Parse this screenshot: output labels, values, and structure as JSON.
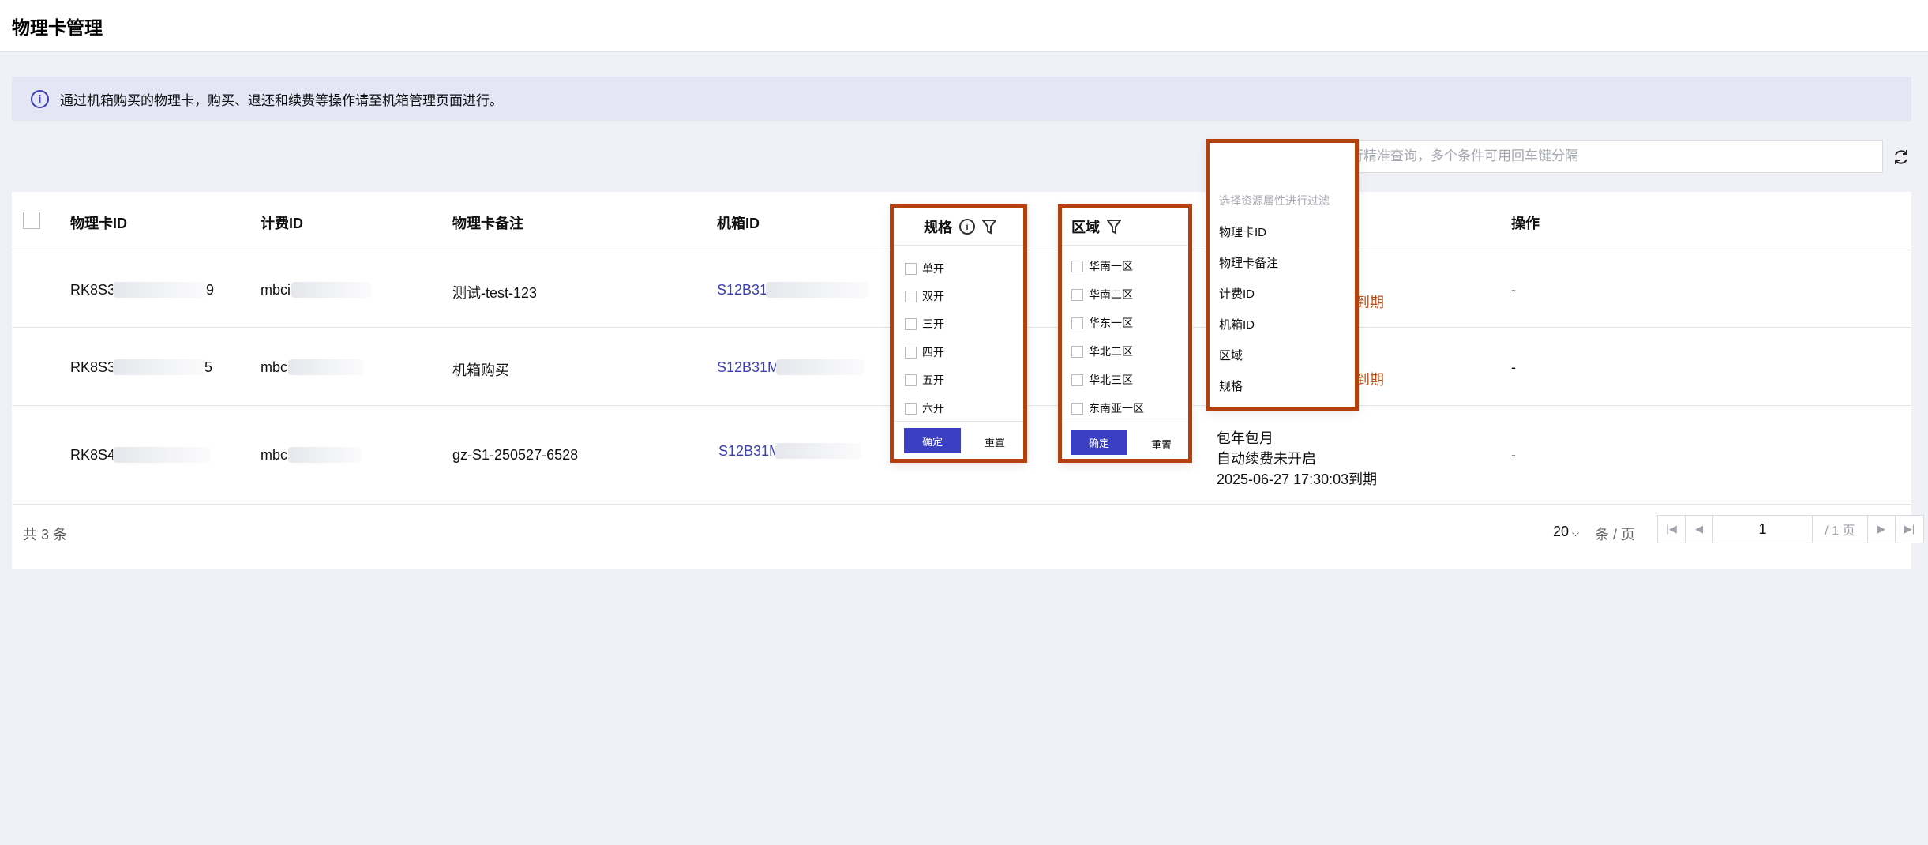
{
  "page": {
    "title": "物理卡管理"
  },
  "notice": {
    "icon": "info-icon",
    "text": "通过机箱购买的物理卡，购买、退还和续费等操作请至机箱管理页面进行。"
  },
  "search": {
    "placeholder": "请输入关键字进行精准查询，多个条件可用回车键分隔"
  },
  "table": {
    "headers": {
      "card_id": "物理卡ID",
      "billing_id": "计费ID",
      "remark": "物理卡备注",
      "chassis_id": "机箱ID",
      "spec": "规格",
      "region": "区域",
      "actions": "操作"
    },
    "rows": [
      {
        "card_id": "RK8S3",
        "card_id_tail": "9",
        "billing_id": "mbci",
        "remark": "测试-test-123",
        "chassis_id": "S12B31",
        "billing_tail": "到期",
        "action": "-"
      },
      {
        "card_id": "RK8S3",
        "card_id_tail": "5",
        "billing_id": "mbc",
        "remark": "机箱购买",
        "chassis_id": "S12B31M",
        "billing_tail": "到期",
        "action": "-"
      },
      {
        "card_id": "RK8S4",
        "billing_id": "mbc",
        "remark": "gz-S1-250527-6528",
        "chassis_id": "S12B31M",
        "billing_mode": "包年包月",
        "auto_renew": "自动续费未开启",
        "expire": "2025-06-27 17:30:03到期",
        "action": "-"
      }
    ]
  },
  "footer": {
    "total": "共 3 条",
    "page_size": "20",
    "page_unit": "条 / 页",
    "current_page": "1",
    "total_pages": "/ 1 页"
  },
  "spec_filter": {
    "title": "规格",
    "options": [
      "单开",
      "双开",
      "三开",
      "四开",
      "五开",
      "六开"
    ],
    "ok": "确定",
    "reset": "重置"
  },
  "region_filter": {
    "title": "区域",
    "options": [
      "华南一区",
      "华南二区",
      "华东一区",
      "华北二区",
      "华北三区",
      "东南亚一区"
    ],
    "ok": "确定",
    "reset": "重置"
  },
  "search_menu": {
    "hint": "选择资源属性进行过滤",
    "items": [
      "物理卡ID",
      "物理卡备注",
      "计费ID",
      "机箱ID",
      "区域",
      "规格"
    ]
  },
  "colors": {
    "accent": "#3b3fc2",
    "link": "#3b3fb0",
    "highlight_border": "#b4400f",
    "warning": "#b4521f"
  }
}
